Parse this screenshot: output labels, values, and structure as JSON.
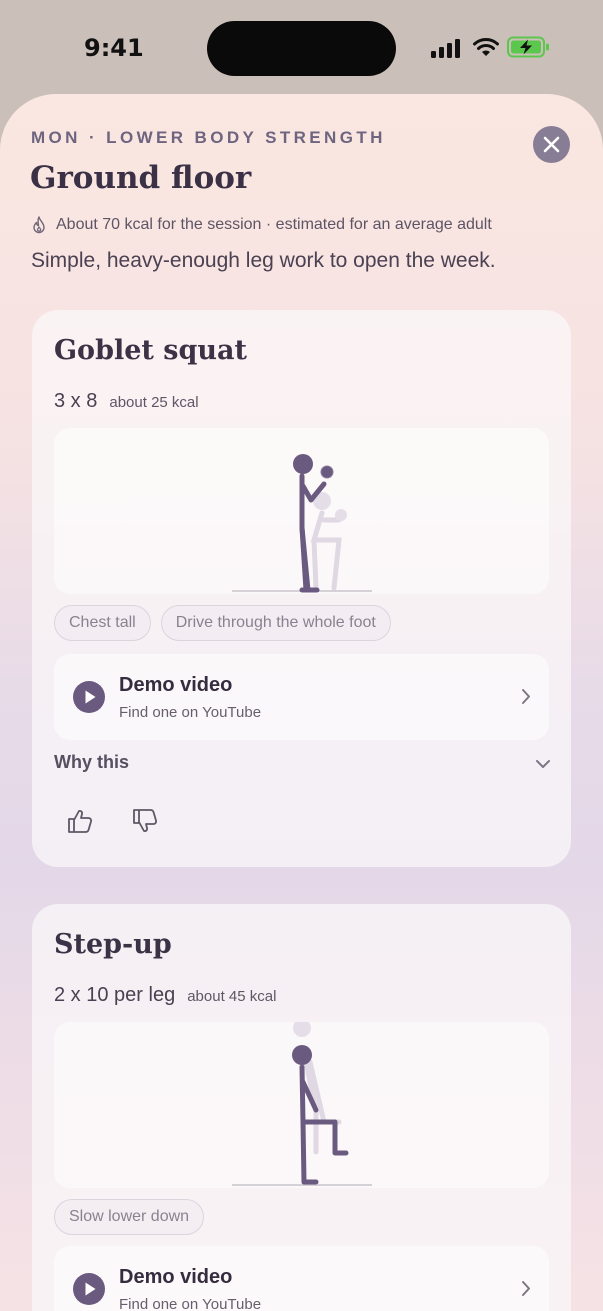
{
  "status_bar": {
    "time": "9:41",
    "icons": [
      "signal-icon",
      "wifi-icon",
      "battery-charging-icon"
    ],
    "battery_color": "#5cc74d"
  },
  "header": {
    "eyebrow": "MON · LOWER BODY STRENGTH",
    "title": "Ground floor",
    "kcal_note": "About 70 kcal for the session · estimated for an average adult",
    "subtitle": "Simple, heavy-enough leg work to open the week.",
    "close_icon": "close-icon"
  },
  "exercises": [
    {
      "name": "Goblet squat",
      "sets": "3 x 8",
      "kcal": "about 25 kcal",
      "illustration": "goblet-squat-figure",
      "cues": [
        "Chest tall",
        "Drive through the whole foot"
      ],
      "demo": {
        "label": "Demo video",
        "sub": "Find one on YouTube"
      },
      "why_label": "Why this"
    },
    {
      "name": "Step-up",
      "sets": "2 x 10 per leg",
      "kcal": "about 45 kcal",
      "illustration": "step-up-figure",
      "cues": [
        "Slow lower down"
      ],
      "demo": {
        "label": "Demo video",
        "sub": "Find one on YouTube"
      }
    }
  ],
  "colors": {
    "accent": "#6b5a80",
    "text_dark": "#3a3146",
    "close_bg": "#877e95"
  }
}
